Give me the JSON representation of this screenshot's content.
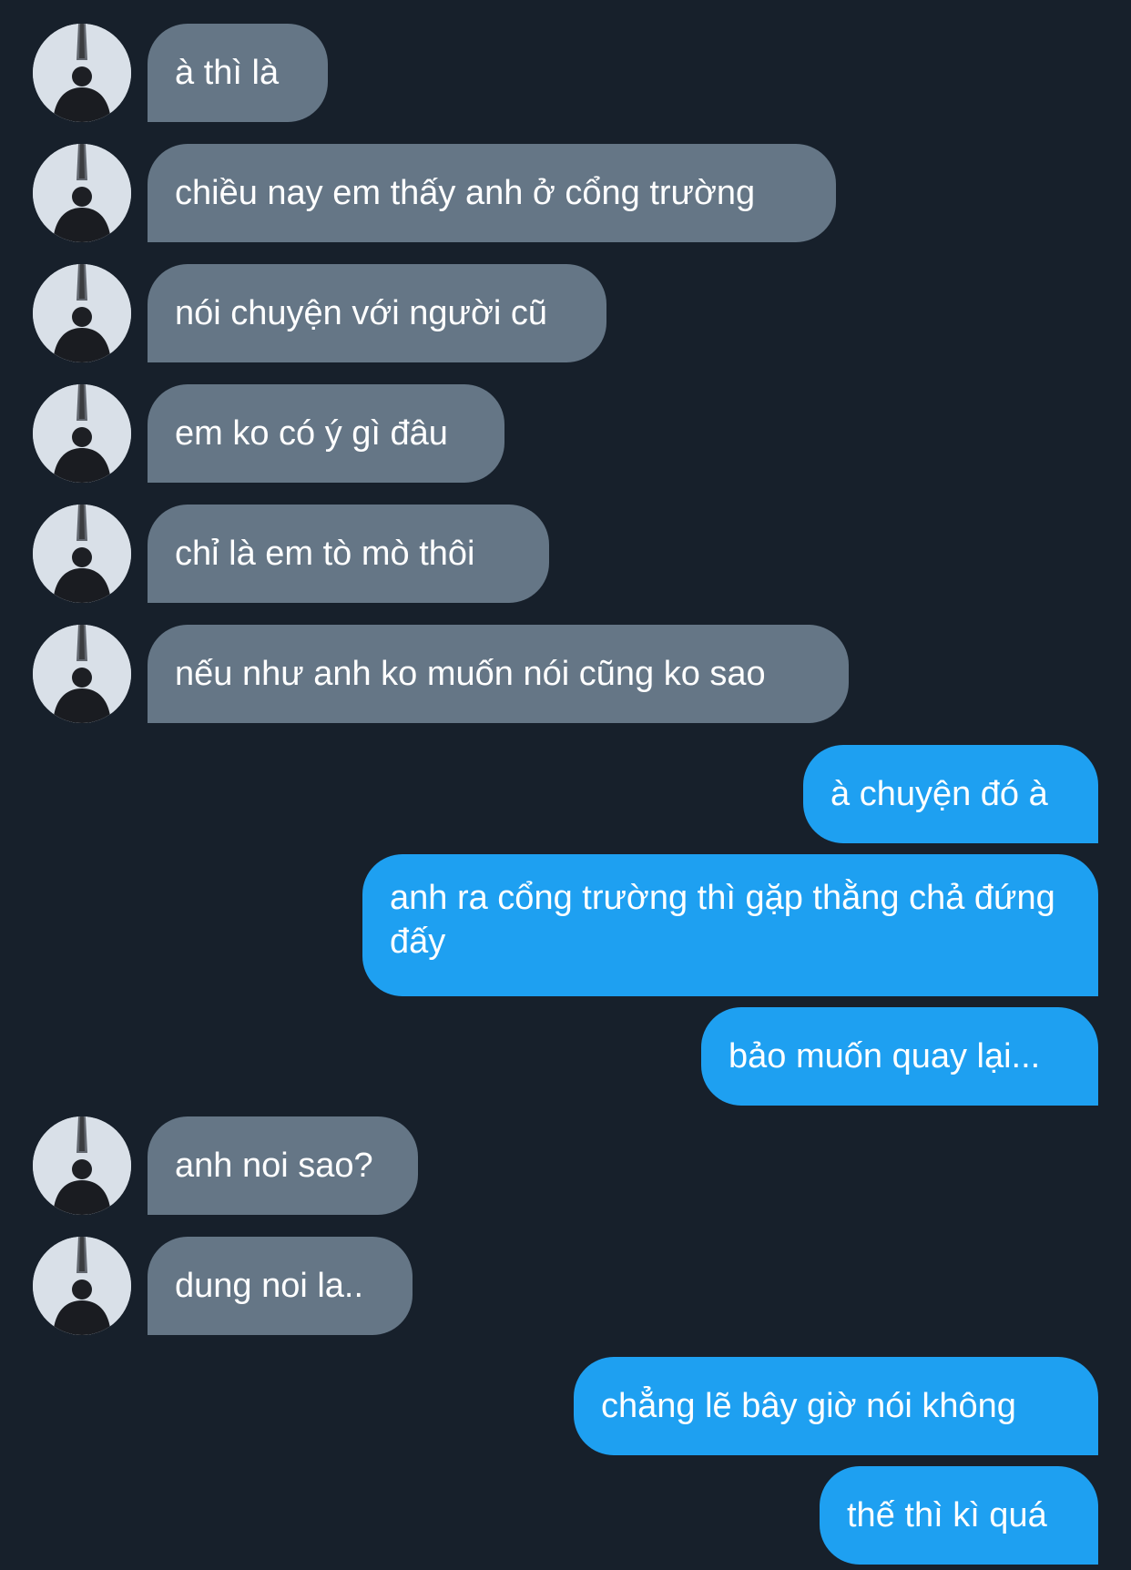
{
  "colors": {
    "background": "#17202b",
    "incoming_bubble": "#657686",
    "outgoing_bubble": "#1ea0f1",
    "text": "#ffffff"
  },
  "avatar_icon": "profile-photo-person-eiffel-tower",
  "messages": [
    {
      "direction": "incoming",
      "text": "à thì là"
    },
    {
      "direction": "incoming",
      "text": "chiều nay em thấy anh ở cổng trường"
    },
    {
      "direction": "incoming",
      "text": "nói chuyện với người cũ"
    },
    {
      "direction": "incoming",
      "text": "em ko có ý gì đâu"
    },
    {
      "direction": "incoming",
      "text": "chỉ là em tò mò thôi"
    },
    {
      "direction": "incoming",
      "text": "nếu như anh ko muốn nói cũng ko sao"
    },
    {
      "direction": "outgoing",
      "text": "à chuyện đó à"
    },
    {
      "direction": "outgoing",
      "text": "anh ra cổng trường thì gặp thằng chả đứng đấy"
    },
    {
      "direction": "outgoing",
      "text": "bảo muốn quay lại..."
    },
    {
      "direction": "incoming",
      "text": "anh noi sao?"
    },
    {
      "direction": "incoming",
      "text": "dung noi la.."
    },
    {
      "direction": "outgoing",
      "text": "chẳng lẽ bây giờ nói không"
    },
    {
      "direction": "outgoing",
      "text": "thế thì kì quá"
    }
  ]
}
